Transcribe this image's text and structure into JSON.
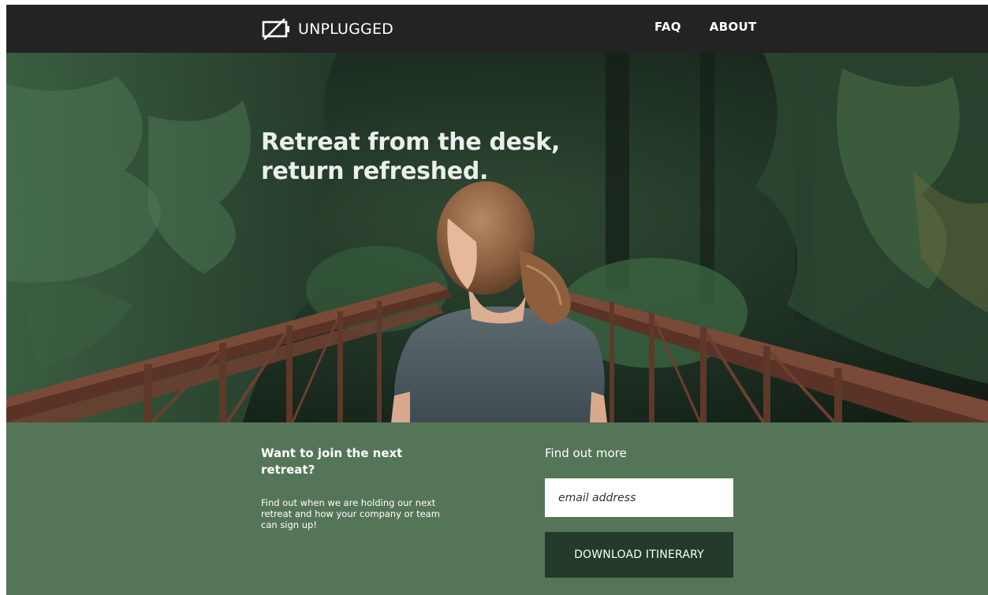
{
  "header": {
    "brand": "UNPLUGGED",
    "brand_icon": "unplugged-battery-icon",
    "nav": [
      {
        "label": "FAQ"
      },
      {
        "label": "ABOUT"
      }
    ]
  },
  "hero": {
    "title_line1": "Retreat from the desk,",
    "title_line2": "return refreshed."
  },
  "join": {
    "heading": "Want to join the next retreat?",
    "text": "Find out when we are holding our next retreat and how your company or team can sign up!"
  },
  "signup": {
    "heading": "Find out more",
    "email_placeholder": "email address",
    "button_label": "DOWNLOAD ITINERARY"
  },
  "colors": {
    "header_bg": "#232323",
    "band_bg": "#557559",
    "button_bg": "#243a2a"
  }
}
